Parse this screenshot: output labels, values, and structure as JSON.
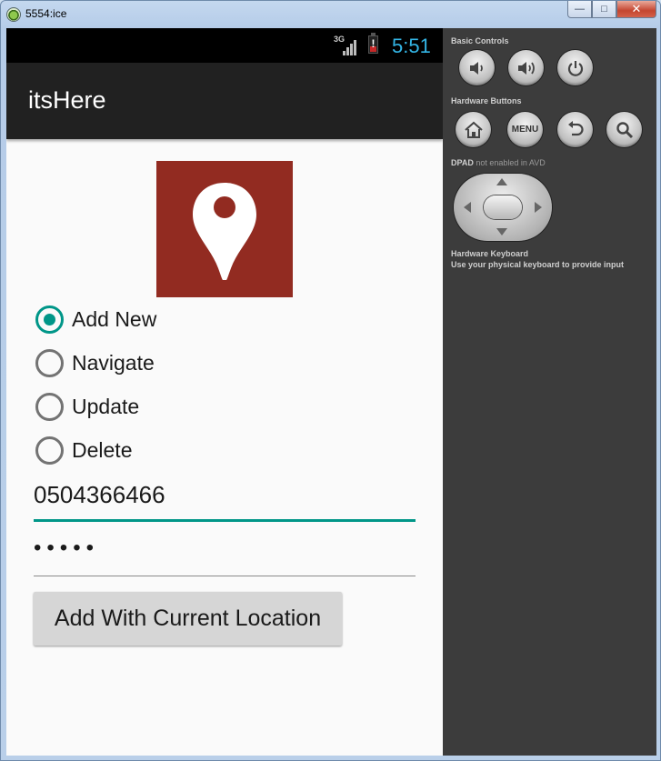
{
  "window": {
    "title": "5554:ice",
    "buttons": {
      "minimize": "—",
      "maximize": "□",
      "close": "✕"
    }
  },
  "status_bar": {
    "network": "3G",
    "time": "5:51",
    "battery_icon": "battery-alert-icon",
    "battery_alert": "!"
  },
  "action_bar": {
    "title": "itsHere"
  },
  "logo": {
    "icon": "map-pin-icon",
    "background": "#922b21"
  },
  "radio_group": {
    "options": [
      {
        "label": "Add New",
        "checked": true
      },
      {
        "label": "Navigate",
        "checked": false
      },
      {
        "label": "Update",
        "checked": false
      },
      {
        "label": "Delete",
        "checked": false
      }
    ]
  },
  "phone_field": {
    "value": "0504366466"
  },
  "password_field": {
    "value": "•••••"
  },
  "submit_button": {
    "label": "Add With Current Location"
  },
  "controls_panel": {
    "basic_controls": "Basic Controls",
    "hardware_buttons": "Hardware Buttons",
    "menu_label": "MENU",
    "dpad_label": "DPAD",
    "dpad_note": " not enabled in AVD",
    "keyboard_title": "Hardware Keyboard",
    "keyboard_note": "Use your physical keyboard to provide input"
  },
  "colors": {
    "accent": "#009688",
    "clock": "#33b5e5",
    "action_bar": "#212121",
    "panel": "#3c3c3c"
  }
}
